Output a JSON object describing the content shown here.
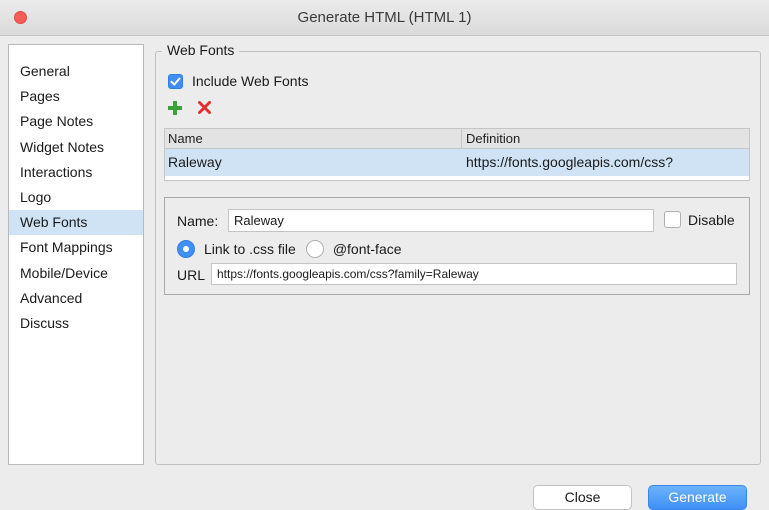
{
  "window": {
    "title": "Generate HTML (HTML 1)"
  },
  "sidebar": {
    "items": [
      {
        "label": "General"
      },
      {
        "label": "Pages"
      },
      {
        "label": "Page Notes"
      },
      {
        "label": "Widget Notes"
      },
      {
        "label": "Interactions"
      },
      {
        "label": "Logo"
      },
      {
        "label": "Web Fonts",
        "selected": true
      },
      {
        "label": "Font Mappings"
      },
      {
        "label": "Mobile/Device"
      },
      {
        "label": "Advanced"
      },
      {
        "label": "Discuss"
      }
    ]
  },
  "web_fonts": {
    "group_label": "Web Fonts",
    "include_label": "Include Web Fonts",
    "include_checked": true,
    "add_icon": "plus-icon",
    "delete_icon": "x-icon",
    "table": {
      "columns": [
        "Name",
        "Definition"
      ],
      "rows": [
        {
          "name": "Raleway",
          "definition": "https://fonts.googleapis.com/css?"
        }
      ]
    },
    "detail": {
      "name_label": "Name:",
      "name_value": "Raleway",
      "disable_label": "Disable",
      "disable_checked": false,
      "link_option": "Link to .css file",
      "fontface_option": "@font-face",
      "selected_option": "Link to .css file",
      "url_label": "URL",
      "url_value": "https://fonts.googleapis.com/css?family=Raleway"
    }
  },
  "footer": {
    "close_label": "Close",
    "generate_label": "Generate"
  },
  "colors": {
    "accent": "#3f8ff7",
    "selection": "#cfe3f5",
    "add": "#3aa23a",
    "delete": "#e03030"
  }
}
